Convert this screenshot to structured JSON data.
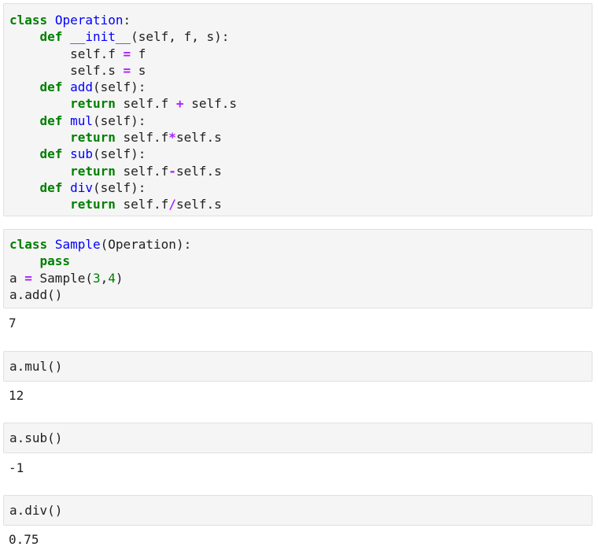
{
  "cells": [
    {
      "lines": [
        [
          {
            "t": "class",
            "c": "kw"
          },
          {
            "t": " "
          },
          {
            "t": "Operation",
            "c": "nm"
          },
          {
            "t": ":"
          }
        ],
        [
          {
            "t": "    "
          },
          {
            "t": "def",
            "c": "kw"
          },
          {
            "t": " "
          },
          {
            "t": "__init__",
            "c": "nm"
          },
          {
            "t": "(self, f, s):"
          }
        ],
        [
          {
            "t": "        self.f "
          },
          {
            "t": "=",
            "c": "op"
          },
          {
            "t": " f"
          }
        ],
        [
          {
            "t": "        self.s "
          },
          {
            "t": "=",
            "c": "op"
          },
          {
            "t": " s"
          }
        ],
        [
          {
            "t": "    "
          },
          {
            "t": "def",
            "c": "kw"
          },
          {
            "t": " "
          },
          {
            "t": "add",
            "c": "nm"
          },
          {
            "t": "(self):"
          }
        ],
        [
          {
            "t": "        "
          },
          {
            "t": "return",
            "c": "kw"
          },
          {
            "t": " self.f "
          },
          {
            "t": "+",
            "c": "op"
          },
          {
            "t": " self.s"
          }
        ],
        [
          {
            "t": "    "
          },
          {
            "t": "def",
            "c": "kw"
          },
          {
            "t": " "
          },
          {
            "t": "mul",
            "c": "nm"
          },
          {
            "t": "(self):"
          }
        ],
        [
          {
            "t": "        "
          },
          {
            "t": "return",
            "c": "kw"
          },
          {
            "t": " self.f"
          },
          {
            "t": "*",
            "c": "op"
          },
          {
            "t": "self.s"
          }
        ],
        [
          {
            "t": "    "
          },
          {
            "t": "def",
            "c": "kw"
          },
          {
            "t": " "
          },
          {
            "t": "sub",
            "c": "nm"
          },
          {
            "t": "(self):"
          }
        ],
        [
          {
            "t": "        "
          },
          {
            "t": "return",
            "c": "kw"
          },
          {
            "t": " self.f"
          },
          {
            "t": "-",
            "c": "op"
          },
          {
            "t": "self.s"
          }
        ],
        [
          {
            "t": "    "
          },
          {
            "t": "def",
            "c": "kw"
          },
          {
            "t": " "
          },
          {
            "t": "div",
            "c": "nm"
          },
          {
            "t": "(self):"
          }
        ],
        [
          {
            "t": "        "
          },
          {
            "t": "return",
            "c": "kw"
          },
          {
            "t": " self.f"
          },
          {
            "t": "/",
            "c": "op"
          },
          {
            "t": "self.s"
          }
        ]
      ],
      "output": null
    },
    {
      "lines": [
        [
          {
            "t": "class",
            "c": "kw"
          },
          {
            "t": " "
          },
          {
            "t": "Sample",
            "c": "nm"
          },
          {
            "t": "(Operation):"
          }
        ],
        [
          {
            "t": "    "
          },
          {
            "t": "pass",
            "c": "kw"
          }
        ],
        [
          {
            "t": "a "
          },
          {
            "t": "=",
            "c": "op"
          },
          {
            "t": " Sample("
          },
          {
            "t": "3",
            "c": "nu"
          },
          {
            "t": ","
          },
          {
            "t": "4",
            "c": "nu"
          },
          {
            "t": ")"
          }
        ],
        [
          {
            "t": "a.add()"
          }
        ]
      ],
      "output": "7"
    },
    {
      "lines": [
        [
          {
            "t": "a.mul()"
          }
        ]
      ],
      "output": "12"
    },
    {
      "lines": [
        [
          {
            "t": "a.sub()"
          }
        ]
      ],
      "output": "-1"
    },
    {
      "lines": [
        [
          {
            "t": "a.div()"
          }
        ]
      ],
      "output": "0.75"
    }
  ]
}
